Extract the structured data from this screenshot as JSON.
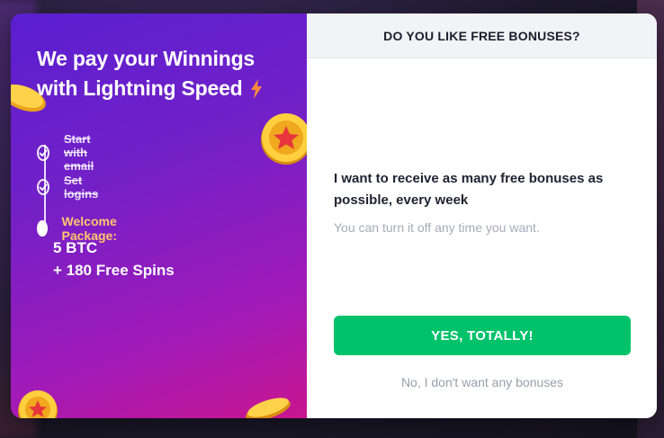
{
  "promo": {
    "title_line1": "We pay your Winnings",
    "title_line2": "with Lightning Speed",
    "steps": [
      {
        "label": "Start with email",
        "done": true
      },
      {
        "label": "Set logins",
        "done": true
      }
    ],
    "package_label": "Welcome Package:",
    "package_line1": "5 BTC",
    "package_line2": "+ 180 Free Spins"
  },
  "panel": {
    "header": "DO YOU LIKE FREE BONUSES?",
    "question": "I want to receive as many free bonuses as possible, every week",
    "hint": "You can turn it off any time you want.",
    "yes_label": "YES, TOTALLY!",
    "no_label": "No, I don't want any bonuses"
  },
  "colors": {
    "accent_green": "#00c26b",
    "package_label": "#ffc76e",
    "bolt": "#ff8a3d"
  },
  "icons": [
    "lightning-icon",
    "check-icon",
    "coin-star-icon"
  ]
}
